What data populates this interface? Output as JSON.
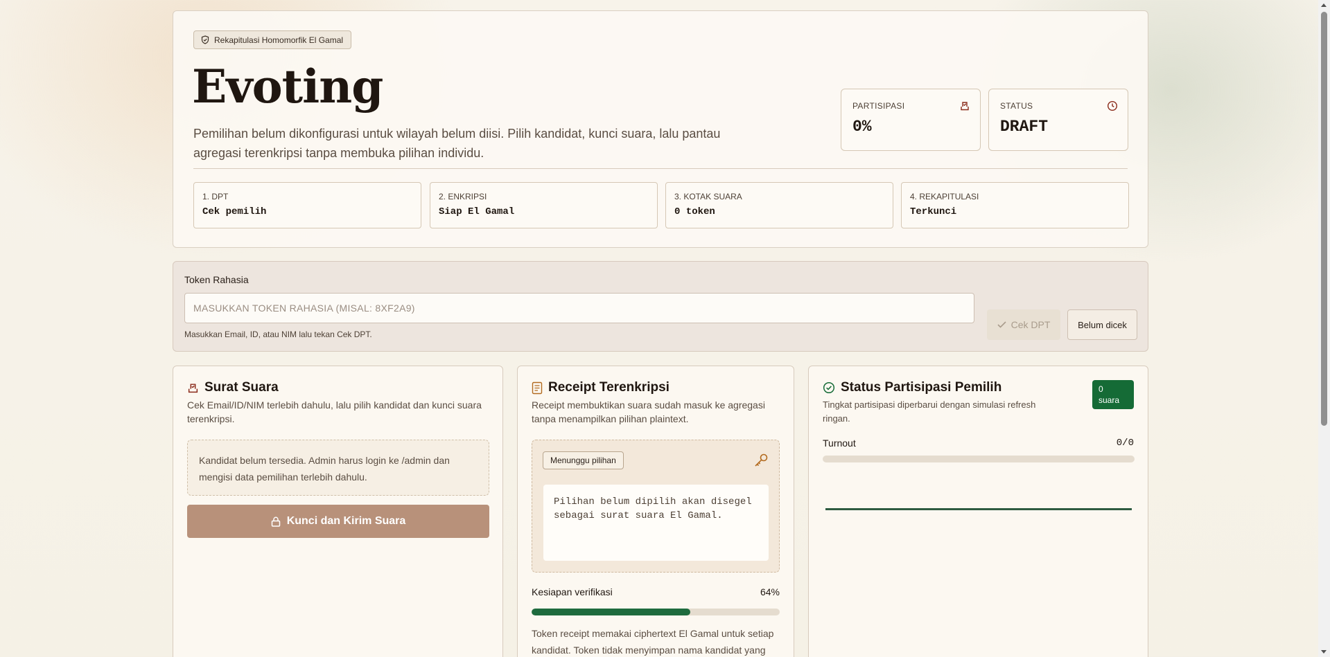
{
  "hero": {
    "badge": "Rekapitulasi Homomorfik El Gamal",
    "title": "Evoting",
    "subtitle": "Pemilihan belum dikonfigurasi untuk wilayah belum diisi. Pilih kandidat, kunci suara, lalu pantau agregasi terenkripsi tanpa membuka pilihan individu.",
    "stats": [
      {
        "label": "PARTISIPASI",
        "value": "0%",
        "icon": "ballot-box-icon"
      },
      {
        "label": "STATUS",
        "value": "DRAFT",
        "icon": "clock-icon"
      }
    ],
    "steps": [
      {
        "label": "1. DPT",
        "value": "Cek pemilih"
      },
      {
        "label": "2. ENKRIPSI",
        "value": "Siap El Gamal"
      },
      {
        "label": "3. KOTAK SUARA",
        "value": "0 token"
      },
      {
        "label": "4. REKAPITULASI",
        "value": "Terkunci"
      }
    ]
  },
  "token": {
    "label": "Token Rahasia",
    "placeholder": "MASUKKAN TOKEN RAHASIA (MISAL: 8XF2A9)",
    "value": "",
    "help": "Masukkan Email, ID, atau NIM lalu tekan Cek DPT.",
    "check_button": "Cek DPT",
    "status_button": "Belum dicek"
  },
  "ballot": {
    "title": "Surat Suara",
    "description": "Cek Email/ID/NIM terlebih dahulu, lalu pilih kandidat dan kunci suara terenkripsi.",
    "empty_message": "Kandidat belum tersedia. Admin harus login ke /admin dan mengisi data pemilihan terlebih dahulu.",
    "submit_button": "Kunci dan Kirim Suara"
  },
  "receipt": {
    "title": "Receipt Terenkripsi",
    "description": "Receipt membuktikan suara sudah masuk ke agregasi tanpa menampilkan pilihan plaintext.",
    "badge": "Menunggu pilihan",
    "placeholder_text": "Pilihan belum dipilih akan disegel sebagai surat suara El Gamal.",
    "verification_label": "Kesiapan verifikasi",
    "verification_percent": "64%",
    "verification_value": 0.64,
    "note": "Token receipt memakai ciphertext El Gamal untuk setiap kandidat. Token tidak menyimpan nama kandidat yang"
  },
  "participation": {
    "title": "Status Partisipasi Pemilih",
    "description": "Tingkat partisipasi diperbarui dengan simulasi refresh ringan.",
    "badge_count": "0",
    "badge_unit": "suara",
    "turnout_label": "Turnout",
    "turnout_value": "0/0",
    "turnout_fraction": 0
  },
  "colors": {
    "accent_green": "#156b36",
    "accent_brown": "#b8917a"
  }
}
